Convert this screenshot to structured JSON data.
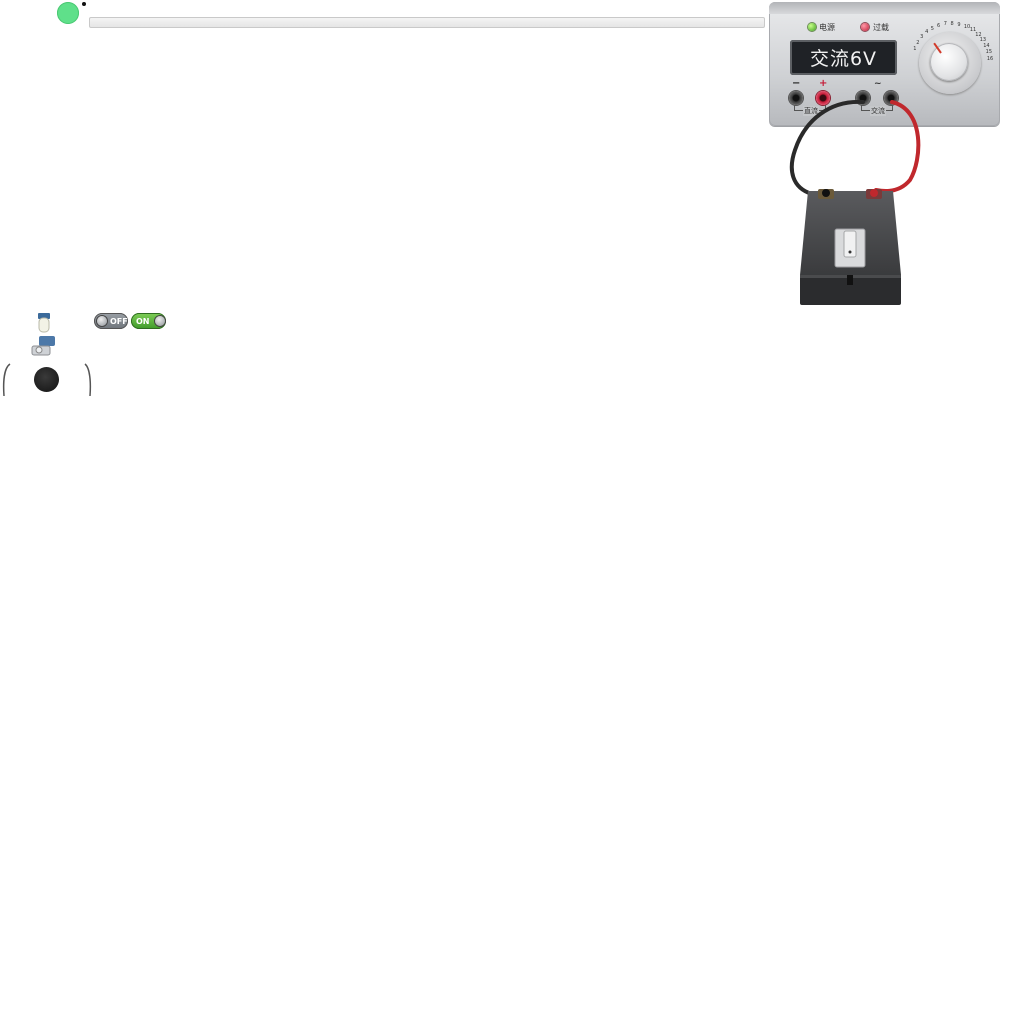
{
  "progress": {
    "fraction": 0.0
  },
  "power_supply": {
    "indicator_power": "电源",
    "indicator_overload": "过载",
    "display": "交流6V",
    "dc_minus": "−",
    "dc_plus": "+",
    "ac_symbol": "~",
    "dc_label": "直流",
    "ac_label": "交流",
    "dial_ticks": [
      "1",
      "2",
      "3",
      "4",
      "5",
      "6",
      "7",
      "8",
      "9",
      "10",
      "11",
      "12",
      "13",
      "14",
      "15",
      "16"
    ],
    "colors": {
      "led_power": "#3ea020",
      "led_overload": "#c0203a",
      "jack_red": "#c51c38"
    }
  },
  "switches": {
    "off_label": "OFF",
    "on_label": "ON"
  },
  "wire_colors": {
    "black": "#2a2a2a",
    "red": "#c0282d"
  }
}
